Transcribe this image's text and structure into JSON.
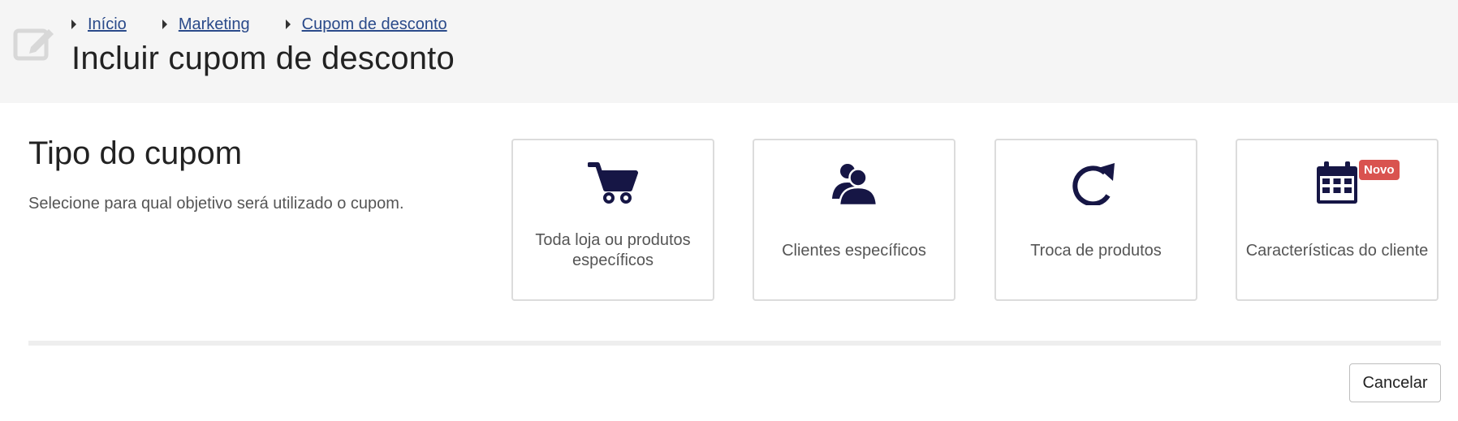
{
  "header": {
    "breadcrumb": [
      "Início",
      "Marketing",
      "Cupom de desconto"
    ],
    "title": "Incluir cupom de desconto",
    "icon": "edit-icon"
  },
  "section": {
    "title": "Tipo do cupom",
    "description": "Selecione para qual objetivo será utilizado o cupom."
  },
  "cards": [
    {
      "label": "Toda loja ou produtos específicos",
      "icon": "cart-icon"
    },
    {
      "label": "Clientes específicos",
      "icon": "users-icon"
    },
    {
      "label": "Troca de produtos",
      "icon": "refresh-icon"
    },
    {
      "label": "Características do cliente",
      "icon": "calendar-icon",
      "badge": "Novo"
    }
  ],
  "actions": {
    "cancel_label": "Cancelar"
  },
  "colors": {
    "icon": "#161645",
    "link": "#2a4a8a",
    "badge": "#d9534f",
    "header_bg": "#f5f5f5"
  }
}
